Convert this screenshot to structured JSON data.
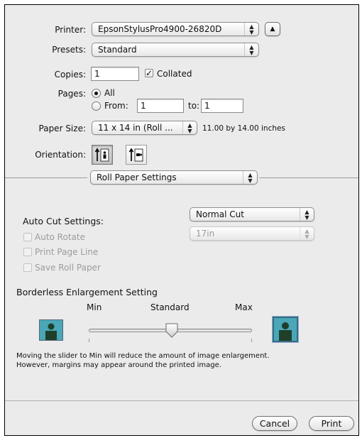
{
  "printer": {
    "label": "Printer:",
    "value": "EpsonStylusPro4900-26820D"
  },
  "presets": {
    "label": "Presets:",
    "value": "Standard"
  },
  "copies": {
    "label": "Copies:",
    "value": "1",
    "collated_label": "Collated",
    "collated_checked": true
  },
  "pages": {
    "label": "Pages:",
    "all_label": "All",
    "from_label": "From:",
    "from_value": "1",
    "to_label": "to:",
    "to_value": "1",
    "selected": "All"
  },
  "paper_size": {
    "label": "Paper Size:",
    "value": "11 x 14 in (Roll ...",
    "dimensions": "11.00 by 14.00 inches"
  },
  "orientation": {
    "label": "Orientation:",
    "selected": "portrait"
  },
  "section_popup": {
    "value": "Roll Paper Settings"
  },
  "auto_cut": {
    "label": "Auto Cut Settings:",
    "value": "Normal Cut"
  },
  "auto_rotate": {
    "label": "Auto Rotate",
    "value": "17in",
    "enabled": false
  },
  "print_page_line": {
    "label": "Print Page Line",
    "enabled": false
  },
  "save_roll_paper": {
    "label": "Save Roll Paper",
    "enabled": false
  },
  "borderless": {
    "title": "Borderless Enlargement Setting",
    "min_label": "Min",
    "standard_label": "Standard",
    "max_label": "Max",
    "slider_level": 0.5,
    "description_line1": "Moving the slider to Min will reduce the amount of image enlargement.",
    "description_line2": "However, margins may appear around the printed image."
  },
  "buttons": {
    "cancel": "Cancel",
    "print": "Print"
  },
  "colors": {
    "dialog_bg": "#ebebeb",
    "image_bg": "#49a7b8",
    "figure": "#1f3f2a"
  }
}
